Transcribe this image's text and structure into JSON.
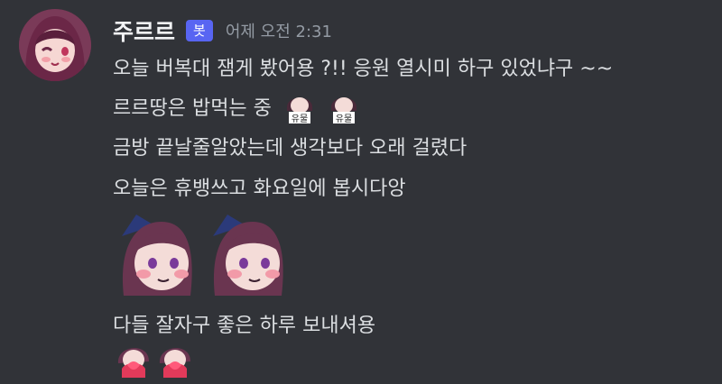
{
  "message": {
    "author": "주르르",
    "bot_tag": "봇",
    "timestamp": "어제 오전 2:31",
    "lines": [
      "오늘 버복대 잼게 봤어용 ?!! 응원 열시미 하구 있었냐구 ~~",
      "르르땅은 밥먹는 중",
      "금방 끝날줄알았는데 생각보다 오래 걸렸다",
      "오늘은 휴뱅쓰고 화요일에 봅시다앙",
      "다들 잘자구 좋은 하루 보내셔용"
    ],
    "emotes": {
      "eating_emote_label": "유물",
      "big_emote_count": 2,
      "small_emote_count": 2
    }
  },
  "colors": {
    "background": "#313338",
    "text": "#dbdee1",
    "username": "#f2f3f5",
    "timestamp": "#949ba4",
    "bot_tag": "#5865f2"
  }
}
